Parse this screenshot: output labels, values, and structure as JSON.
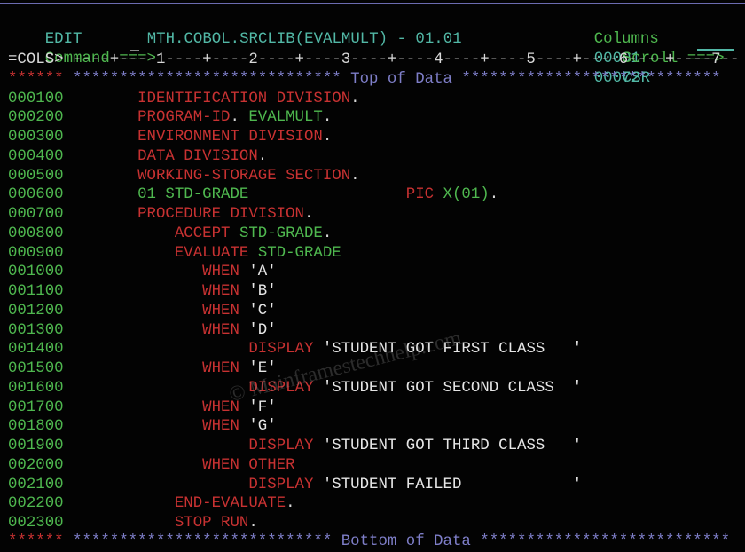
{
  "header": {
    "mode": "EDIT",
    "dataset": "MTH.COBOL.SRCLIB(EVALMULT) - 01.01",
    "columns_label": "Columns",
    "columns_from": "00001",
    "columns_to": "00072",
    "command_label": "Command ===>",
    "command_value": "",
    "scroll_label": "Scroll ===>",
    "scroll_value": "CSR"
  },
  "ruler": {
    "label": "=COLS>",
    "scale": " ----+----1----+----2----+----3----+----4----+----5----+----6----+----7--"
  },
  "top_marker": {
    "stars_prefix": "******",
    "stars_left": " ***************************** ",
    "text": "Top of Data",
    "stars_right": " ****************************"
  },
  "bottom_marker": {
    "stars_prefix": "******",
    "stars_left": " **************************** ",
    "text": "Bottom of Data",
    "stars_right": " ***************************"
  },
  "lines": [
    {
      "num": "000100",
      "segments": [
        {
          "t": "       ",
          "c": "white"
        },
        {
          "t": "IDENTIFICATION DIVISION",
          "c": "red"
        },
        {
          "t": ".",
          "c": "white"
        }
      ]
    },
    {
      "num": "000200",
      "segments": [
        {
          "t": "       ",
          "c": "white"
        },
        {
          "t": "PROGRAM-ID",
          "c": "red"
        },
        {
          "t": ". ",
          "c": "white"
        },
        {
          "t": "EVALMULT",
          "c": "green"
        },
        {
          "t": ".",
          "c": "white"
        }
      ]
    },
    {
      "num": "000300",
      "segments": [
        {
          "t": "       ",
          "c": "white"
        },
        {
          "t": "ENVIRONMENT DIVISION",
          "c": "red"
        },
        {
          "t": ".",
          "c": "white"
        }
      ]
    },
    {
      "num": "000400",
      "segments": [
        {
          "t": "       ",
          "c": "white"
        },
        {
          "t": "DATA DIVISION",
          "c": "red"
        },
        {
          "t": ".",
          "c": "white"
        }
      ]
    },
    {
      "num": "000500",
      "segments": [
        {
          "t": "       ",
          "c": "white"
        },
        {
          "t": "WORKING-STORAGE SECTION",
          "c": "red"
        },
        {
          "t": ".",
          "c": "white"
        }
      ]
    },
    {
      "num": "000600",
      "segments": [
        {
          "t": "       ",
          "c": "white"
        },
        {
          "t": "01 STD-GRADE",
          "c": "green"
        },
        {
          "t": "                 ",
          "c": "white"
        },
        {
          "t": "PIC ",
          "c": "red"
        },
        {
          "t": "X(01)",
          "c": "green"
        },
        {
          "t": ".",
          "c": "white"
        }
      ]
    },
    {
      "num": "000700",
      "segments": [
        {
          "t": "       ",
          "c": "white"
        },
        {
          "t": "PROCEDURE DIVISION",
          "c": "red"
        },
        {
          "t": ".",
          "c": "white"
        }
      ]
    },
    {
      "num": "000800",
      "segments": [
        {
          "t": "           ",
          "c": "white"
        },
        {
          "t": "ACCEPT ",
          "c": "red"
        },
        {
          "t": "STD-GRADE",
          "c": "green"
        },
        {
          "t": ".",
          "c": "white"
        }
      ]
    },
    {
      "num": "000900",
      "segments": [
        {
          "t": "           ",
          "c": "white"
        },
        {
          "t": "EVALUATE ",
          "c": "red"
        },
        {
          "t": "STD-GRADE",
          "c": "green"
        }
      ]
    },
    {
      "num": "001000",
      "segments": [
        {
          "t": "              ",
          "c": "white"
        },
        {
          "t": "WHEN ",
          "c": "red"
        },
        {
          "t": "'A'",
          "c": "bright"
        }
      ]
    },
    {
      "num": "001100",
      "segments": [
        {
          "t": "              ",
          "c": "white"
        },
        {
          "t": "WHEN ",
          "c": "red"
        },
        {
          "t": "'B'",
          "c": "bright"
        }
      ]
    },
    {
      "num": "001200",
      "segments": [
        {
          "t": "              ",
          "c": "white"
        },
        {
          "t": "WHEN ",
          "c": "red"
        },
        {
          "t": "'C'",
          "c": "bright"
        }
      ]
    },
    {
      "num": "001300",
      "segments": [
        {
          "t": "              ",
          "c": "white"
        },
        {
          "t": "WHEN ",
          "c": "red"
        },
        {
          "t": "'D'",
          "c": "bright"
        }
      ]
    },
    {
      "num": "001400",
      "segments": [
        {
          "t": "                   ",
          "c": "white"
        },
        {
          "t": "DISPLAY ",
          "c": "red"
        },
        {
          "t": "'STUDENT GOT FIRST CLASS   '",
          "c": "bright"
        }
      ]
    },
    {
      "num": "001500",
      "segments": [
        {
          "t": "              ",
          "c": "white"
        },
        {
          "t": "WHEN ",
          "c": "red"
        },
        {
          "t": "'E'",
          "c": "bright"
        }
      ]
    },
    {
      "num": "001600",
      "segments": [
        {
          "t": "                   ",
          "c": "white"
        },
        {
          "t": "DISPLAY ",
          "c": "red"
        },
        {
          "t": "'STUDENT GOT SECOND CLASS  '",
          "c": "bright"
        }
      ]
    },
    {
      "num": "001700",
      "segments": [
        {
          "t": "              ",
          "c": "white"
        },
        {
          "t": "WHEN ",
          "c": "red"
        },
        {
          "t": "'F'",
          "c": "bright"
        }
      ]
    },
    {
      "num": "001800",
      "segments": [
        {
          "t": "              ",
          "c": "white"
        },
        {
          "t": "WHEN ",
          "c": "red"
        },
        {
          "t": "'G'",
          "c": "bright"
        }
      ]
    },
    {
      "num": "001900",
      "segments": [
        {
          "t": "                   ",
          "c": "white"
        },
        {
          "t": "DISPLAY ",
          "c": "red"
        },
        {
          "t": "'STUDENT GOT THIRD CLASS   '",
          "c": "bright"
        }
      ]
    },
    {
      "num": "002000",
      "segments": [
        {
          "t": "              ",
          "c": "white"
        },
        {
          "t": "WHEN ",
          "c": "red"
        },
        {
          "t": "OTHER",
          "c": "red"
        }
      ]
    },
    {
      "num": "002100",
      "segments": [
        {
          "t": "                   ",
          "c": "white"
        },
        {
          "t": "DISPLAY ",
          "c": "red"
        },
        {
          "t": "'STUDENT FAILED            '",
          "c": "bright"
        }
      ]
    },
    {
      "num": "002200",
      "segments": [
        {
          "t": "           ",
          "c": "white"
        },
        {
          "t": "END-EVALUATE",
          "c": "red"
        },
        {
          "t": ".",
          "c": "white"
        }
      ]
    },
    {
      "num": "002300",
      "segments": [
        {
          "t": "           ",
          "c": "white"
        },
        {
          "t": "STOP RUN",
          "c": "red"
        },
        {
          "t": ".",
          "c": "white"
        }
      ]
    }
  ],
  "watermark": "© Mainframestechhelp.com",
  "colors": {
    "teal": "#52b8a6",
    "green": "#4fb84f",
    "red": "#c83232",
    "blue": "#7e7ec8",
    "white": "#d8d8d8",
    "background": "#030303"
  }
}
